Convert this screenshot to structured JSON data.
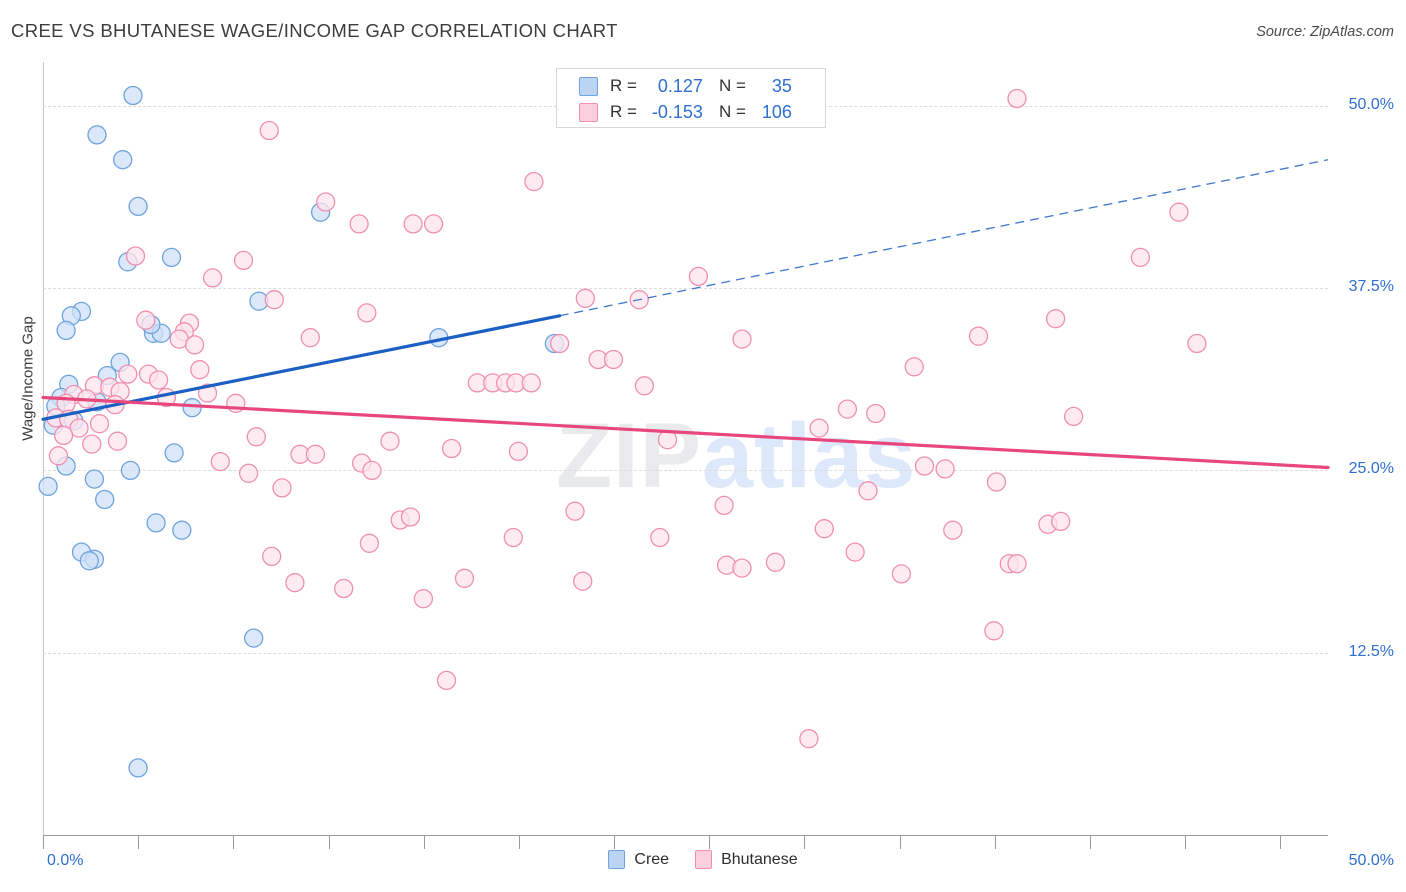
{
  "header": {
    "title": "CREE VS BHUTANESE WAGE/INCOME GAP CORRELATION CHART",
    "source": "Source: ZipAtlas.com"
  },
  "watermark": {
    "part1": "ZIP",
    "part2": "atlas"
  },
  "legend_stats": {
    "rows": [
      {
        "series": "Cree",
        "r_label": "R =",
        "r_value": "0.127",
        "n_label": "N =",
        "n_value": "35",
        "color": "#bad4f2"
      },
      {
        "series": "Bhutanese",
        "r_label": "R =",
        "r_value": "-0.153",
        "n_label": "N =",
        "n_value": "106",
        "color": "#fbcfdd"
      }
    ]
  },
  "bottom_legend": {
    "items": [
      {
        "label": "Cree",
        "color": "#bad4f2"
      },
      {
        "label": "Bhutanese",
        "color": "#fbcfdd"
      }
    ]
  },
  "chart_data": {
    "type": "scatter",
    "title": "CREE VS BHUTANESE WAGE/INCOME GAP CORRELATION CHART",
    "xlabel": "",
    "ylabel": "Wage/Income Gap",
    "xlim": [
      0.0,
      50.0
    ],
    "ylim": [
      0.0,
      53.0
    ],
    "grid": true,
    "x_tick_labels": [
      "0.0%",
      "50.0%"
    ],
    "y_tick_labels": [
      "12.5%",
      "25.0%",
      "37.5%",
      "50.0%"
    ],
    "y_tick_values": [
      12.5,
      25.0,
      37.5,
      50.0
    ],
    "legend_position": "bottom-center",
    "accent_colors": {
      "blue_fill": "#cfe0f7",
      "blue_stroke": "#6fa3dd",
      "pink_fill": "#fce4ec",
      "pink_stroke": "#f08fb0",
      "blue_line": "#1c5fc4",
      "pink_line": "#e8477e",
      "tick_text": "#2f6fd0"
    },
    "series": [
      {
        "name": "Cree",
        "r": 0.127,
        "n": 35,
        "marker_fill": "#cfe0f7",
        "marker_stroke": "#6fa3dd",
        "trend": {
          "color": "#1c5fc4",
          "x0": 0.0,
          "y0": 28.5,
          "x1": 20.1,
          "y1": 35.6,
          "dashed_to_x": 50.0,
          "dashed_to_y": 46.3
        },
        "points": [
          [
            3.5,
            50.7
          ],
          [
            2.1,
            48.0
          ],
          [
            3.1,
            46.3
          ],
          [
            3.7,
            43.1
          ],
          [
            10.8,
            42.7
          ],
          [
            5.0,
            39.6
          ],
          [
            3.3,
            39.3
          ],
          [
            1.5,
            35.9
          ],
          [
            1.1,
            35.6
          ],
          [
            8.4,
            36.6
          ],
          [
            0.9,
            34.6
          ],
          [
            4.3,
            34.4
          ],
          [
            4.6,
            34.4
          ],
          [
            4.2,
            35.0
          ],
          [
            15.4,
            34.1
          ],
          [
            19.9,
            33.7
          ],
          [
            3.0,
            32.4
          ],
          [
            2.5,
            31.5
          ],
          [
            1.0,
            30.9
          ],
          [
            0.7,
            30.0
          ],
          [
            0.5,
            29.4
          ],
          [
            2.1,
            29.7
          ],
          [
            5.8,
            29.3
          ],
          [
            1.2,
            28.4
          ],
          [
            0.4,
            28.1
          ],
          [
            5.1,
            26.2
          ],
          [
            0.9,
            25.3
          ],
          [
            3.4,
            25.0
          ],
          [
            2.0,
            24.4
          ],
          [
            0.2,
            23.9
          ],
          [
            2.4,
            23.0
          ],
          [
            4.4,
            21.4
          ],
          [
            5.4,
            20.9
          ],
          [
            1.5,
            19.4
          ],
          [
            2.0,
            18.9
          ],
          [
            1.8,
            18.8
          ],
          [
            8.2,
            13.5
          ],
          [
            3.7,
            4.6
          ]
        ]
      },
      {
        "name": "Bhutanese",
        "r": -0.153,
        "n": 106,
        "marker_fill": "#fce4ec",
        "marker_stroke": "#f08fb0",
        "trend": {
          "color": "#e8477e",
          "x0": 0.0,
          "y0": 30.0,
          "x1": 50.0,
          "y1": 25.2
        },
        "points": [
          [
            37.9,
            50.5
          ],
          [
            8.8,
            48.3
          ],
          [
            19.1,
            44.8
          ],
          [
            11.0,
            43.4
          ],
          [
            12.3,
            41.9
          ],
          [
            14.4,
            41.9
          ],
          [
            15.2,
            41.9
          ],
          [
            44.2,
            42.7
          ],
          [
            3.6,
            39.7
          ],
          [
            7.8,
            39.4
          ],
          [
            42.7,
            39.6
          ],
          [
            6.6,
            38.2
          ],
          [
            25.5,
            38.3
          ],
          [
            21.1,
            36.8
          ],
          [
            23.2,
            36.7
          ],
          [
            9.0,
            36.7
          ],
          [
            12.6,
            35.8
          ],
          [
            4.0,
            35.3
          ],
          [
            5.7,
            35.1
          ],
          [
            39.4,
            35.4
          ],
          [
            5.5,
            34.5
          ],
          [
            5.3,
            34.0
          ],
          [
            5.9,
            33.6
          ],
          [
            10.4,
            34.1
          ],
          [
            27.2,
            34.0
          ],
          [
            36.4,
            34.2
          ],
          [
            44.9,
            33.7
          ],
          [
            20.1,
            33.7
          ],
          [
            21.6,
            32.6
          ],
          [
            22.2,
            32.6
          ],
          [
            33.9,
            32.1
          ],
          [
            3.3,
            31.6
          ],
          [
            4.1,
            31.6
          ],
          [
            4.5,
            31.2
          ],
          [
            2.0,
            30.8
          ],
          [
            2.6,
            30.7
          ],
          [
            3.0,
            30.4
          ],
          [
            16.9,
            31.0
          ],
          [
            17.5,
            31.0
          ],
          [
            18.0,
            31.0
          ],
          [
            18.4,
            31.0
          ],
          [
            19.0,
            31.0
          ],
          [
            23.4,
            30.8
          ],
          [
            6.4,
            30.3
          ],
          [
            1.2,
            30.2
          ],
          [
            1.7,
            29.9
          ],
          [
            0.9,
            29.6
          ],
          [
            2.8,
            29.5
          ],
          [
            7.5,
            29.6
          ],
          [
            31.3,
            29.2
          ],
          [
            32.4,
            28.9
          ],
          [
            40.1,
            28.7
          ],
          [
            0.5,
            28.6
          ],
          [
            1.0,
            28.5
          ],
          [
            30.2,
            27.9
          ],
          [
            8.3,
            27.3
          ],
          [
            13.5,
            27.0
          ],
          [
            24.3,
            27.1
          ],
          [
            15.9,
            26.5
          ],
          [
            10.0,
            26.1
          ],
          [
            10.6,
            26.1
          ],
          [
            18.5,
            26.3
          ],
          [
            0.6,
            26.0
          ],
          [
            6.9,
            25.6
          ],
          [
            12.4,
            25.5
          ],
          [
            12.8,
            25.0
          ],
          [
            34.3,
            25.3
          ],
          [
            35.1,
            25.1
          ],
          [
            8.0,
            24.8
          ],
          [
            9.3,
            23.8
          ],
          [
            37.1,
            24.2
          ],
          [
            32.1,
            23.6
          ],
          [
            26.5,
            22.6
          ],
          [
            20.7,
            22.2
          ],
          [
            13.9,
            21.6
          ],
          [
            14.3,
            21.8
          ],
          [
            39.1,
            21.3
          ],
          [
            39.6,
            21.5
          ],
          [
            30.4,
            21.0
          ],
          [
            35.4,
            20.9
          ],
          [
            18.3,
            20.4
          ],
          [
            24.0,
            20.4
          ],
          [
            12.7,
            20.0
          ],
          [
            31.6,
            19.4
          ],
          [
            8.9,
            19.1
          ],
          [
            26.6,
            18.5
          ],
          [
            27.2,
            18.3
          ],
          [
            28.5,
            18.7
          ],
          [
            37.6,
            18.6
          ],
          [
            37.9,
            18.6
          ],
          [
            33.4,
            17.9
          ],
          [
            9.8,
            17.3
          ],
          [
            16.4,
            17.6
          ],
          [
            21.0,
            17.4
          ],
          [
            11.7,
            16.9
          ],
          [
            14.8,
            16.2
          ],
          [
            37.0,
            14.0
          ],
          [
            15.7,
            10.6
          ],
          [
            29.8,
            6.6
          ],
          [
            1.4,
            27.9
          ],
          [
            2.2,
            28.2
          ],
          [
            1.9,
            26.8
          ],
          [
            0.8,
            27.4
          ],
          [
            2.9,
            27.0
          ],
          [
            6.1,
            31.9
          ],
          [
            4.8,
            30.0
          ]
        ]
      }
    ]
  }
}
